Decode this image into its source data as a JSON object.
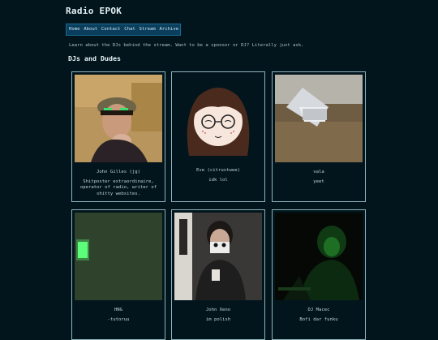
{
  "site": {
    "title": "Radio EPOK"
  },
  "nav": {
    "items": [
      "Home",
      "About",
      "Contact",
      "Chat",
      "Stream",
      "Archive"
    ]
  },
  "intro": "Learn about the DJs behind the stream. Want to be a sponsor or DJ? Literally just ask.",
  "section_heading": "DJs and Dudes",
  "djs": [
    {
      "name": "John Gilles (jg)",
      "bio": "Shitposter extraordinaire, operator of radio, writer of shitty websites."
    },
    {
      "name": "Eve (citrustwee)",
      "bio": "idk lol"
    },
    {
      "name": "vala",
      "bio": "yeet"
    },
    {
      "name": "HNG",
      "bio": "-tutoruu"
    },
    {
      "name": "John Xeno",
      "bio": "im polish"
    },
    {
      "name": "DJ Macec",
      "bio": "Bofi dar funku"
    }
  ],
  "colors": {
    "background": "#02151c",
    "nav_bg": "#0a3e5c",
    "card_border": "#8fb3bd",
    "text": "#c9dde3"
  }
}
